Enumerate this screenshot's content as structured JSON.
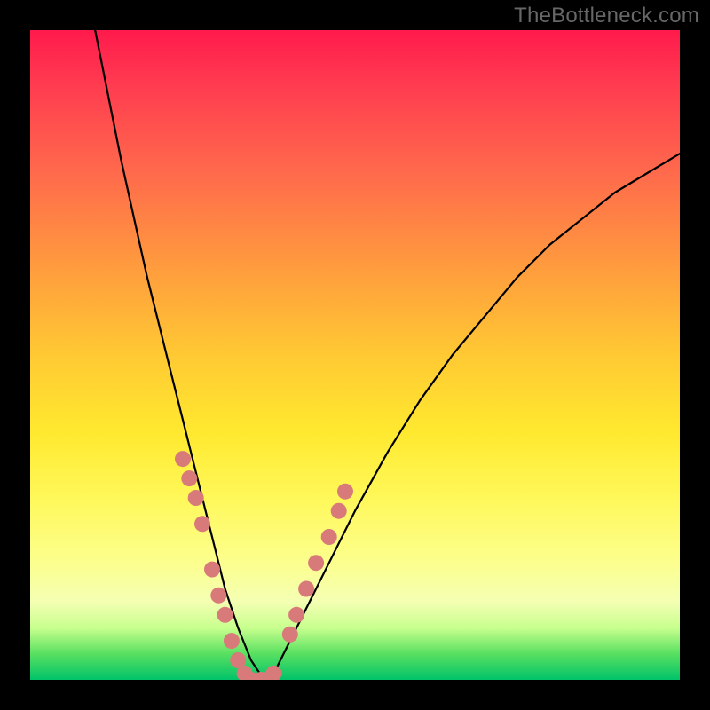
{
  "watermark": "TheBottleneck.com",
  "chart_data": {
    "type": "line",
    "title": "",
    "xlabel": "",
    "ylabel": "",
    "xlim": [
      0,
      100
    ],
    "ylim": [
      0,
      100
    ],
    "series": [
      {
        "name": "bottleneck-curve",
        "x": [
          10,
          12,
          14,
          16,
          18,
          20,
          22,
          24,
          26,
          28,
          30,
          32,
          34,
          36,
          38,
          40,
          45,
          50,
          55,
          60,
          65,
          70,
          75,
          80,
          85,
          90,
          95,
          100
        ],
        "y": [
          100,
          90,
          80,
          71,
          62,
          54,
          46,
          38,
          30,
          22,
          14,
          8,
          3,
          0,
          2,
          6,
          16,
          26,
          35,
          43,
          50,
          56,
          62,
          67,
          71,
          75,
          78,
          81
        ]
      }
    ],
    "markers": {
      "name": "highlighted-points",
      "x": [
        23.5,
        24.5,
        25.5,
        26.5,
        28.0,
        29.0,
        30.0,
        31.0,
        32.0,
        33.0,
        34.0,
        35.5,
        36.5,
        37.5,
        40.0,
        41.0,
        42.5,
        44.0,
        46.0,
        47.5,
        48.5
      ],
      "y": [
        34,
        31,
        28,
        24,
        17,
        13,
        10,
        6,
        3,
        1,
        0,
        0,
        0,
        1,
        7,
        10,
        14,
        18,
        22,
        26,
        29
      ]
    },
    "gradient_legend": {
      "top_color": "#ff1a4c",
      "bottom_color": "#00c36a",
      "meaning": "red high to green low"
    }
  }
}
